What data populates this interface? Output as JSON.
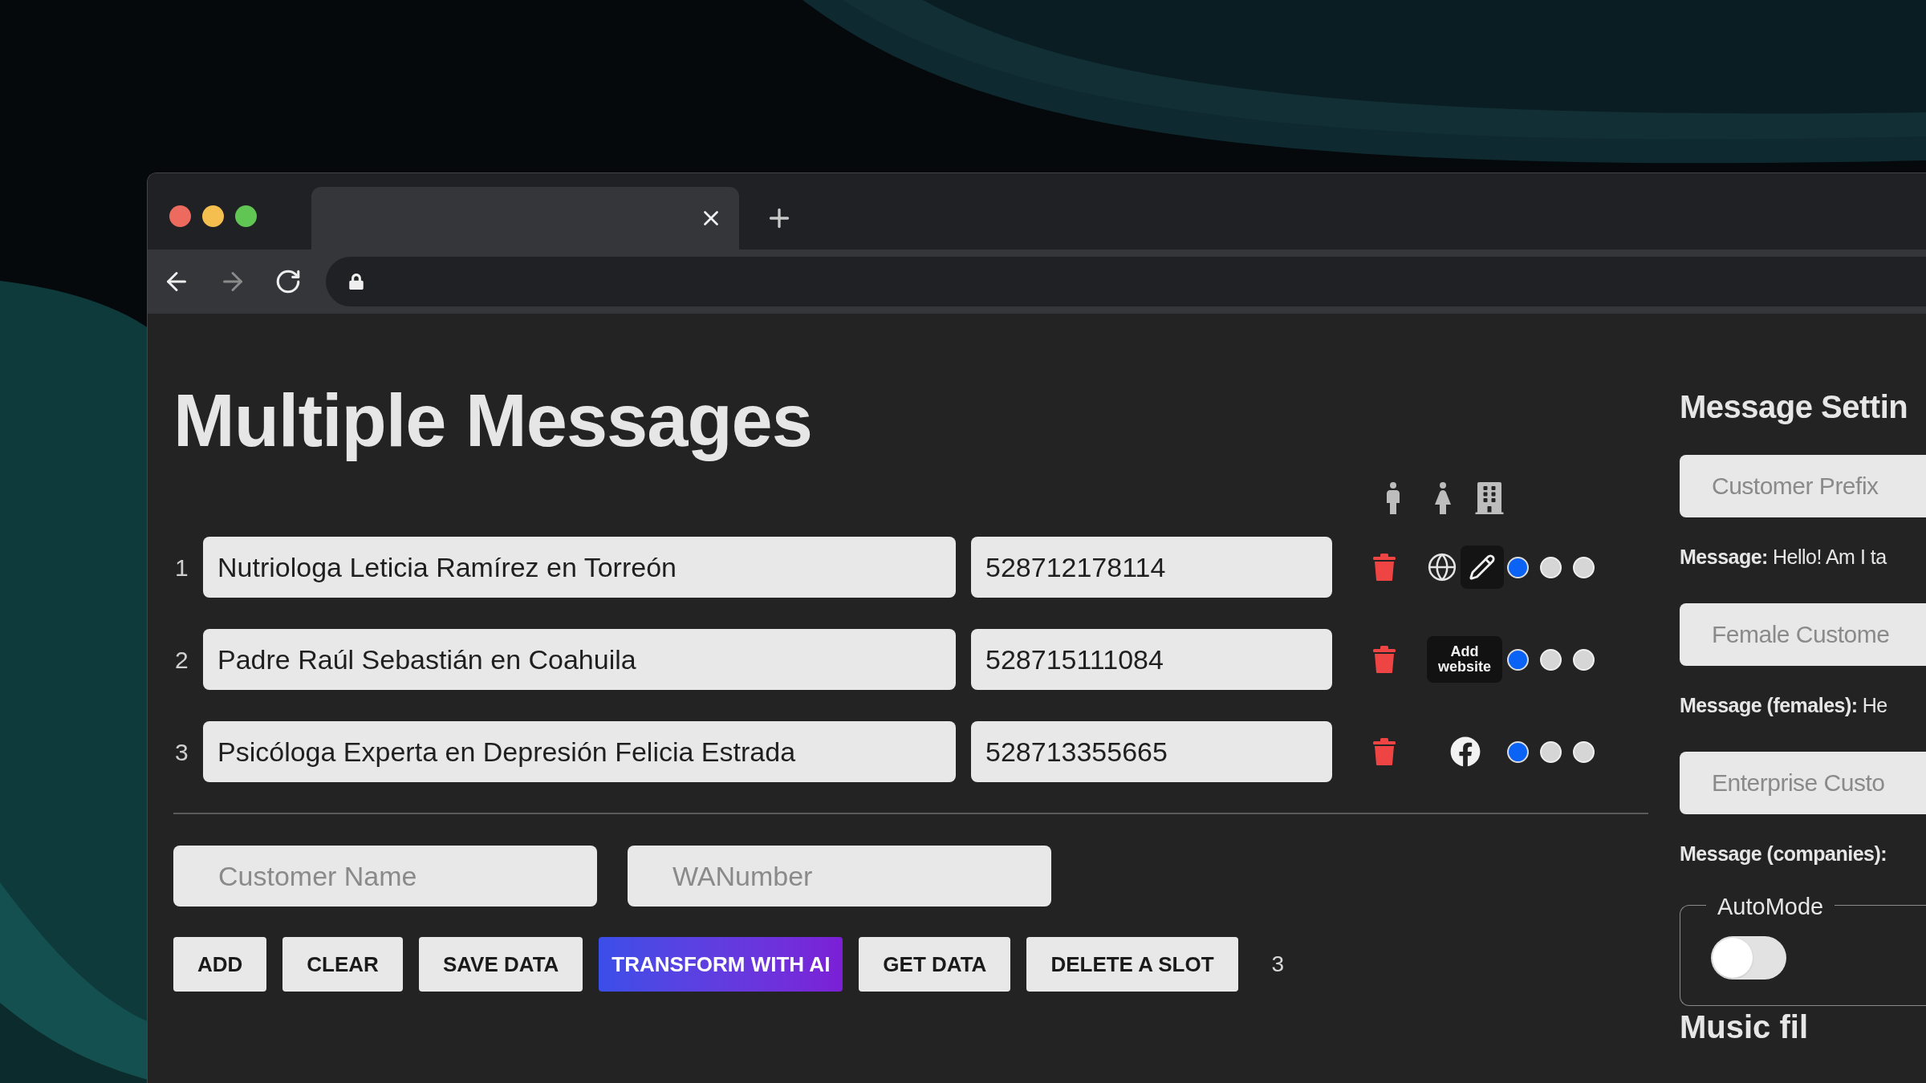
{
  "page": {
    "title": "Multiple Messages"
  },
  "rows": [
    {
      "index": "1",
      "name": "Nutriologa Leticia Ramírez en Torreón",
      "number": "528712178114",
      "link": {
        "kind": "website_edit"
      },
      "types": [
        {
          "selected": true
        },
        {
          "selected": false
        },
        {
          "selected": false
        }
      ]
    },
    {
      "index": "2",
      "name": "Padre Raúl Sebastián en Coahuila",
      "number": "528715111084",
      "link": {
        "kind": "add_website",
        "label": "Add website"
      },
      "types": [
        {
          "selected": true
        },
        {
          "selected": false
        },
        {
          "selected": false
        }
      ]
    },
    {
      "index": "3",
      "name": "Psicóloga Experta en Depresión Felicia Estrada",
      "number": "528713355665",
      "link": {
        "kind": "facebook"
      },
      "types": [
        {
          "selected": true
        },
        {
          "selected": false
        },
        {
          "selected": false
        }
      ]
    }
  ],
  "new_entry": {
    "name_placeholder": "Customer Name",
    "number_placeholder": "WANumber"
  },
  "buttons": [
    {
      "label": "ADD",
      "kind": "plain"
    },
    {
      "label": "CLEAR",
      "kind": "plain"
    },
    {
      "label": "SAVE DATA",
      "kind": "plain"
    },
    {
      "label": "TRANSFORM WITH AI",
      "kind": "gradient"
    },
    {
      "label": "GET DATA",
      "kind": "plain"
    },
    {
      "label": "DELETE A SLOT",
      "kind": "plain"
    }
  ],
  "slot_count": "3",
  "settings": {
    "title": "Message Settin",
    "fields": [
      {
        "placeholder": "Customer Prefix",
        "label": "Message:",
        "text": "Hello! Am I ta"
      },
      {
        "placeholder": "Female Custome",
        "label": "Message (females):",
        "text": "He"
      },
      {
        "placeholder": "Enterprise Custo",
        "label": "Message (companies):"
      }
    ],
    "automode": {
      "legend": "AutoMode",
      "on": false
    },
    "next_heading": "Music fil"
  }
}
